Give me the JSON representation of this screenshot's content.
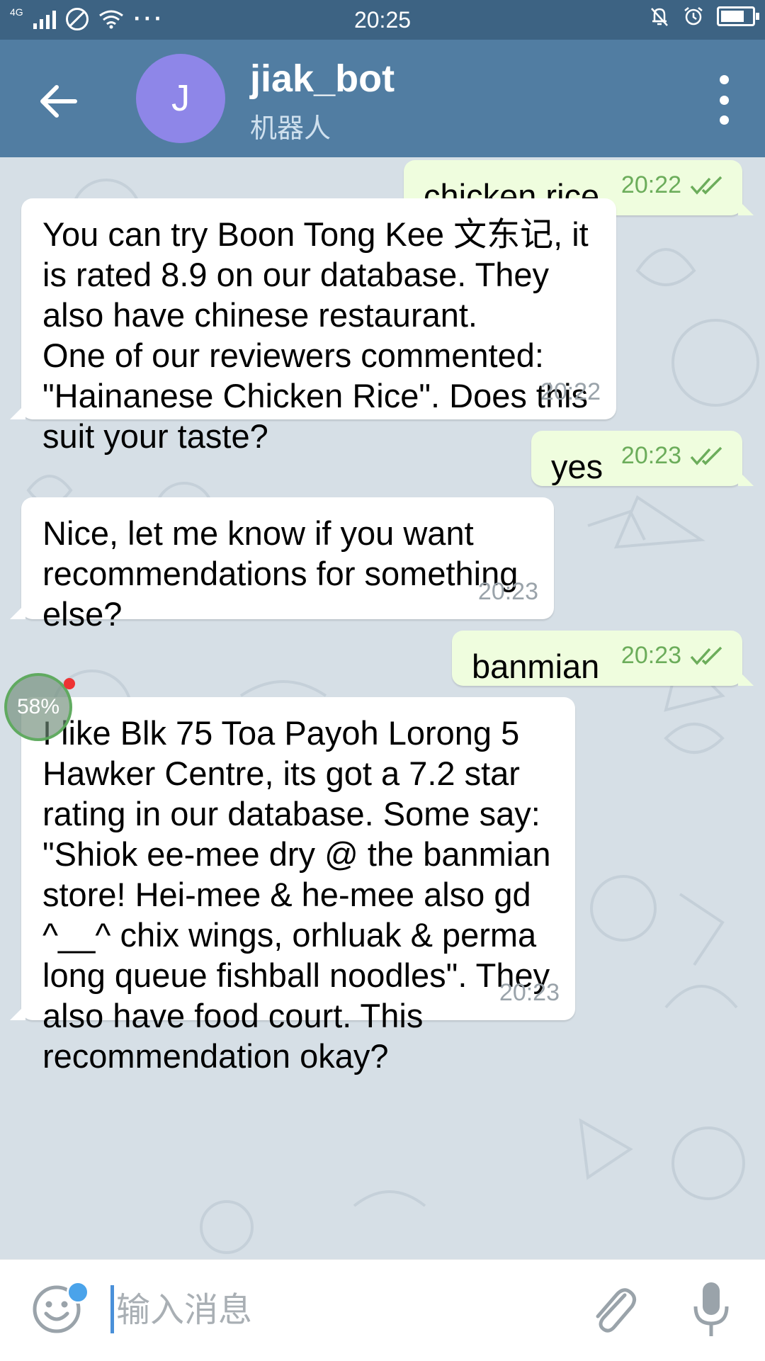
{
  "status_bar": {
    "network": "4G",
    "time": "20:25",
    "dots": "···"
  },
  "header": {
    "avatar_letter": "J",
    "title": "jiak_bot",
    "subtitle": "机器人"
  },
  "messages": [
    {
      "direction": "out",
      "text": "chicken rice",
      "time": "20:22"
    },
    {
      "direction": "in",
      "text": "You can try Boon Tong Kee 文东记, it\nis rated 8.9 on our database. They\nalso have chinese restaurant.\nOne of our reviewers commented:\n\"Hainanese Chicken Rice\". Does this\nsuit your taste?",
      "time": "20:22"
    },
    {
      "direction": "out",
      "text": "yes",
      "time": "20:23"
    },
    {
      "direction": "in",
      "text": "Nice, let me know if you want\nrecommendations for something\nelse?",
      "time": "20:23"
    },
    {
      "direction": "out",
      "text": "banmian",
      "time": "20:23"
    },
    {
      "direction": "in",
      "text": "I like Blk 75 Toa Payoh Lorong 5\nHawker Centre, its got a 7.2 star\nrating in our database. Some say:\n\"Shiok ee-mee dry @ the banmian\nstore! Hei-mee & he-mee also gd\n^__^ chix wings, orhluak & perma\nlong queue fishball noodles\". They\nalso have food court. This\nrecommendation okay?",
      "time": "20:23"
    }
  ],
  "overlay": {
    "percent": "58%"
  },
  "input": {
    "placeholder": "输入消息",
    "value": ""
  },
  "colors": {
    "header": "#517da2",
    "status_bar": "#3d6383",
    "outgoing_bubble": "#effdde",
    "incoming_bubble": "#ffffff",
    "read_ticks": "#6cad5b",
    "avatar": "#8e86e8"
  },
  "icons": {
    "back": "arrow-left-icon",
    "more": "more-vertical-icon",
    "emoji": "emoji-icon",
    "attach": "paperclip-icon",
    "mic": "microphone-icon",
    "read": "double-check-icon"
  }
}
